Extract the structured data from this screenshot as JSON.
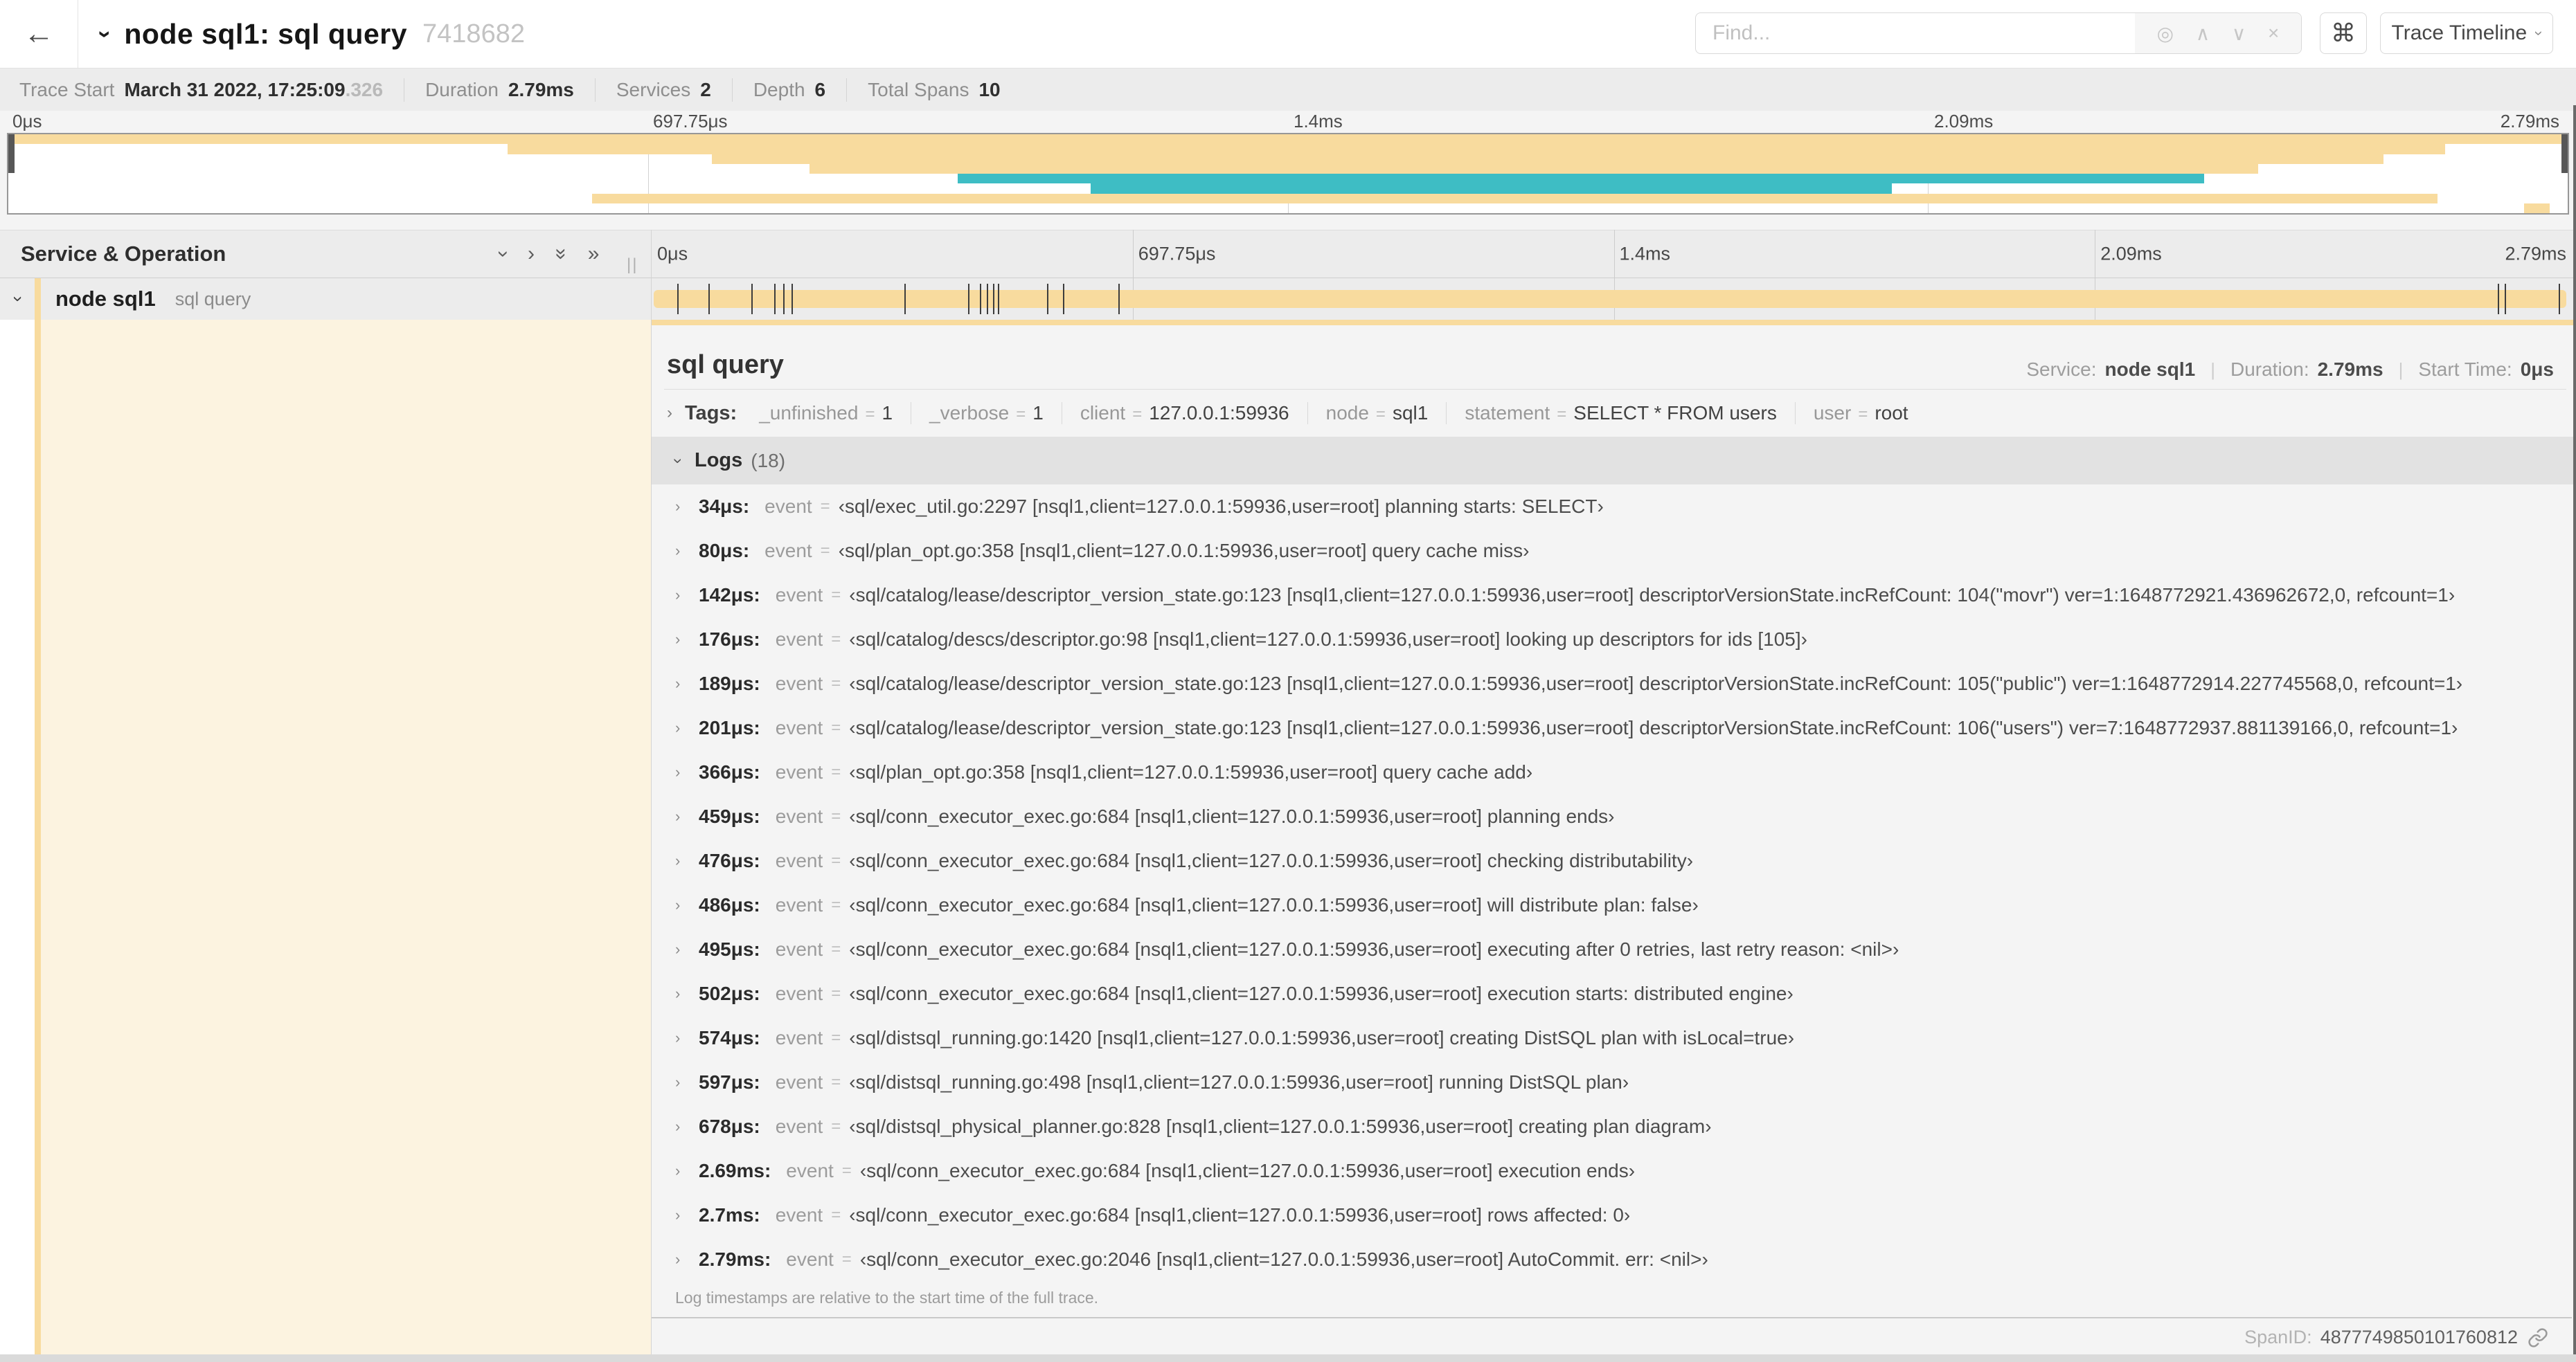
{
  "colors": {
    "span_orange": "#F8DB9E",
    "span_teal": "#3EBDC4",
    "name_column_tint": "#FCF3E0"
  },
  "icons": {
    "back": "←",
    "chevron": "›",
    "double_chevron": "»",
    "command": "⌘",
    "locate": "◎",
    "up": "∧",
    "down": "∨",
    "clear": "×",
    "resizer": "||"
  },
  "header": {
    "title": "node sql1: sql query",
    "trace_id": "7418682",
    "find_placeholder": "Find...",
    "view_select_label": "Trace Timeline"
  },
  "trace_stats": {
    "items": [
      {
        "label": "Trace Start",
        "value": "March 31 2022, 17:25:09",
        "suffix": ".326"
      },
      {
        "label": "Duration",
        "value": "2.79ms"
      },
      {
        "label": "Services",
        "value": "2"
      },
      {
        "label": "Depth",
        "value": "6"
      },
      {
        "label": "Total Spans",
        "value": "10"
      }
    ]
  },
  "minimap": {
    "labels": [
      {
        "text": "0μs",
        "pct": 0
      },
      {
        "text": "697.75μs",
        "pct": 25
      },
      {
        "text": "1.4ms",
        "pct": 50
      },
      {
        "text": "2.09ms",
        "pct": 75
      },
      {
        "text": "2.79ms",
        "pct": 100
      }
    ],
    "gridlines_pct": [
      25,
      50,
      75
    ],
    "bars": [
      {
        "row": 0,
        "start": 0,
        "end": 100,
        "color": "orange"
      },
      {
        "row": 1,
        "start": 19.5,
        "end": 95.2,
        "color": "orange"
      },
      {
        "row": 2,
        "start": 27.5,
        "end": 92.8,
        "color": "orange"
      },
      {
        "row": 3,
        "start": 31.3,
        "end": 87.9,
        "color": "orange"
      },
      {
        "row": 4,
        "start": 37.1,
        "end": 85.8,
        "color": "teal"
      },
      {
        "row": 5,
        "start": 42.3,
        "end": 73.6,
        "color": "teal"
      },
      {
        "row": 6,
        "start": 22.8,
        "end": 94.9,
        "color": "orange"
      },
      {
        "row": 7,
        "start": 98.3,
        "end": 99.3,
        "color": "orange"
      }
    ]
  },
  "timeline": {
    "column_header": "Service & Operation",
    "span_row": {
      "service": "node sql1",
      "operation": "sql query",
      "ticks_pct": [
        1.22,
        2.87,
        5.09,
        6.31,
        6.77,
        7.2,
        13.12,
        16.45,
        17.06,
        17.42,
        17.74,
        17.99,
        20.57,
        21.4,
        24.3,
        96.42,
        96.77,
        99.6
      ]
    }
  },
  "detail": {
    "title": "sql query",
    "meta": [
      {
        "label": "Service:",
        "value": "node sql1"
      },
      {
        "label": "Duration:",
        "value": "2.79ms"
      },
      {
        "label": "Start Time:",
        "value": "0μs"
      }
    ],
    "tags_label": "Tags:",
    "tags": [
      {
        "key": "_unfinished",
        "value": "1"
      },
      {
        "key": "_verbose",
        "value": "1"
      },
      {
        "key": "client",
        "value": "127.0.0.1:59936"
      },
      {
        "key": "node",
        "value": "sql1"
      },
      {
        "key": "statement",
        "value": "SELECT * FROM users"
      },
      {
        "key": "user",
        "value": "root"
      }
    ],
    "logs_label": "Logs",
    "logs_count": "(18)",
    "log_field_key": "event",
    "logs": [
      {
        "t": "34μs:",
        "msg": "‹sql/exec_util.go:2297 [nsql1,client=127.0.0.1:59936,user=root] planning starts: SELECT›"
      },
      {
        "t": "80μs:",
        "msg": "‹sql/plan_opt.go:358 [nsql1,client=127.0.0.1:59936,user=root] query cache miss›"
      },
      {
        "t": "142μs:",
        "msg": "‹sql/catalog/lease/descriptor_version_state.go:123 [nsql1,client=127.0.0.1:59936,user=root] descriptorVersionState.incRefCount: 104(\"movr\") ver=1:1648772921.436962672,0, refcount=1›"
      },
      {
        "t": "176μs:",
        "msg": "‹sql/catalog/descs/descriptor.go:98 [nsql1,client=127.0.0.1:59936,user=root] looking up descriptors for ids [105]›"
      },
      {
        "t": "189μs:",
        "msg": "‹sql/catalog/lease/descriptor_version_state.go:123 [nsql1,client=127.0.0.1:59936,user=root] descriptorVersionState.incRefCount: 105(\"public\") ver=1:1648772914.227745568,0, refcount=1›"
      },
      {
        "t": "201μs:",
        "msg": "‹sql/catalog/lease/descriptor_version_state.go:123 [nsql1,client=127.0.0.1:59936,user=root] descriptorVersionState.incRefCount: 106(\"users\") ver=7:1648772937.881139166,0, refcount=1›"
      },
      {
        "t": "366μs:",
        "msg": "‹sql/plan_opt.go:358 [nsql1,client=127.0.0.1:59936,user=root] query cache add›"
      },
      {
        "t": "459μs:",
        "msg": "‹sql/conn_executor_exec.go:684 [nsql1,client=127.0.0.1:59936,user=root] planning ends›"
      },
      {
        "t": "476μs:",
        "msg": "‹sql/conn_executor_exec.go:684 [nsql1,client=127.0.0.1:59936,user=root] checking distributability›"
      },
      {
        "t": "486μs:",
        "msg": "‹sql/conn_executor_exec.go:684 [nsql1,client=127.0.0.1:59936,user=root] will distribute plan: false›"
      },
      {
        "t": "495μs:",
        "msg": "‹sql/conn_executor_exec.go:684 [nsql1,client=127.0.0.1:59936,user=root] executing after 0 retries, last retry reason: <nil>›"
      },
      {
        "t": "502μs:",
        "msg": "‹sql/conn_executor_exec.go:684 [nsql1,client=127.0.0.1:59936,user=root] execution starts: distributed engine›"
      },
      {
        "t": "574μs:",
        "msg": "‹sql/distsql_running.go:1420 [nsql1,client=127.0.0.1:59936,user=root] creating DistSQL plan with isLocal=true›"
      },
      {
        "t": "597μs:",
        "msg": "‹sql/distsql_running.go:498 [nsql1,client=127.0.0.1:59936,user=root] running DistSQL plan›"
      },
      {
        "t": "678μs:",
        "msg": "‹sql/distsql_physical_planner.go:828 [nsql1,client=127.0.0.1:59936,user=root] creating plan diagram›"
      },
      {
        "t": "2.69ms:",
        "msg": "‹sql/conn_executor_exec.go:684 [nsql1,client=127.0.0.1:59936,user=root] execution ends›"
      },
      {
        "t": "2.7ms:",
        "msg": "‹sql/conn_executor_exec.go:684 [nsql1,client=127.0.0.1:59936,user=root] rows affected: 0›"
      },
      {
        "t": "2.79ms:",
        "msg": "‹sql/conn_executor_exec.go:2046 [nsql1,client=127.0.0.1:59936,user=root] AutoCommit. err: <nil>›"
      }
    ],
    "logs_note": "Log timestamps are relative to the start time of the full trace.",
    "spanid_label": "SpanID:",
    "spanid_value": "4877749850101760812"
  }
}
